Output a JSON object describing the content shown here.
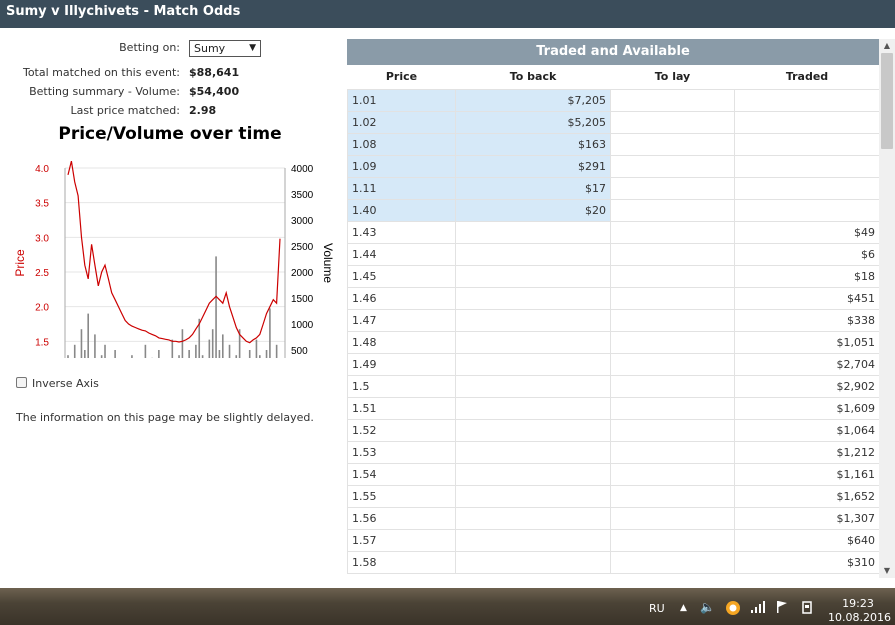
{
  "window": {
    "title": "Sumy v Illychivets - Match Odds"
  },
  "summary": {
    "betting_on_label": "Betting on:",
    "betting_on_value": "Sumy",
    "total_matched_label": "Total matched on this event:",
    "total_matched_value": "$88,641",
    "betting_summary_label": "Betting summary - Volume:",
    "betting_summary_value": "$54,400",
    "last_price_label": "Last price matched:",
    "last_price_value": "2.98"
  },
  "chart_data": {
    "type": "line",
    "title": "Price/Volume over time",
    "ylabel": "Price",
    "y2label": "Volume",
    "ylim": [
      1.0,
      4.0
    ],
    "y2lim": [
      0,
      4000
    ],
    "yticks": [
      "1.0",
      "1.5",
      "2.0",
      "2.5",
      "3.0",
      "3.5",
      "4.0"
    ],
    "y2ticks": [
      "0",
      "500",
      "1000",
      "1500",
      "2000",
      "2500",
      "3000",
      "3500",
      "4000"
    ],
    "grid": true,
    "series": [
      {
        "name": "Price",
        "color": "#cc0000",
        "values": [
          3.9,
          4.1,
          3.8,
          3.6,
          3.0,
          2.6,
          2.4,
          2.9,
          2.6,
          2.3,
          2.5,
          2.6,
          2.4,
          2.2,
          2.1,
          2.0,
          1.9,
          1.8,
          1.75,
          1.72,
          1.7,
          1.68,
          1.66,
          1.65,
          1.62,
          1.6,
          1.58,
          1.55,
          1.54,
          1.53,
          1.52,
          1.5,
          1.5,
          1.49,
          1.5,
          1.52,
          1.55,
          1.6,
          1.68,
          1.75,
          1.85,
          1.95,
          2.05,
          2.1,
          2.15,
          2.1,
          2.05,
          2.2,
          2.0,
          1.85,
          1.7,
          1.6,
          1.55,
          1.5,
          1.48,
          1.52,
          1.55,
          1.6,
          1.75,
          1.9,
          2.0,
          2.1,
          2.05,
          2.98
        ]
      },
      {
        "name": "Volume",
        "color": "#888888",
        "values": [
          400,
          200,
          600,
          300,
          900,
          500,
          1200,
          300,
          800,
          200,
          400,
          600,
          300,
          150,
          500,
          200,
          300,
          100,
          250,
          400,
          150,
          300,
          200,
          600,
          180,
          350,
          120,
          500,
          250,
          300,
          150,
          700,
          200,
          400,
          900,
          300,
          500,
          200,
          600,
          1100,
          400,
          300,
          700,
          900,
          2300,
          500,
          800,
          300,
          600,
          250,
          400,
          900,
          200,
          300,
          500,
          150,
          700,
          400,
          250,
          500,
          1300,
          300,
          600,
          200
        ]
      }
    ]
  },
  "controls": {
    "inverse_axis_label": "Inverse Axis"
  },
  "notice": "The information on this page may be slightly delayed.",
  "table": {
    "header": "Traded and Available",
    "columns": [
      "Price",
      "To back",
      "To lay",
      "Traded"
    ],
    "rows": [
      {
        "price": "1.01",
        "back": "$7,205",
        "lay": "",
        "traded": ""
      },
      {
        "price": "1.02",
        "back": "$5,205",
        "lay": "",
        "traded": ""
      },
      {
        "price": "1.08",
        "back": "$163",
        "lay": "",
        "traded": ""
      },
      {
        "price": "1.09",
        "back": "$291",
        "lay": "",
        "traded": ""
      },
      {
        "price": "1.11",
        "back": "$17",
        "lay": "",
        "traded": ""
      },
      {
        "price": "1.40",
        "back": "$20",
        "lay": "",
        "traded": ""
      },
      {
        "price": "1.43",
        "back": "",
        "lay": "",
        "traded": "$49"
      },
      {
        "price": "1.44",
        "back": "",
        "lay": "",
        "traded": "$6"
      },
      {
        "price": "1.45",
        "back": "",
        "lay": "",
        "traded": "$18"
      },
      {
        "price": "1.46",
        "back": "",
        "lay": "",
        "traded": "$451"
      },
      {
        "price": "1.47",
        "back": "",
        "lay": "",
        "traded": "$338"
      },
      {
        "price": "1.48",
        "back": "",
        "lay": "",
        "traded": "$1,051"
      },
      {
        "price": "1.49",
        "back": "",
        "lay": "",
        "traded": "$2,704"
      },
      {
        "price": "1.5",
        "back": "",
        "lay": "",
        "traded": "$2,902"
      },
      {
        "price": "1.51",
        "back": "",
        "lay": "",
        "traded": "$1,609"
      },
      {
        "price": "1.52",
        "back": "",
        "lay": "",
        "traded": "$1,064"
      },
      {
        "price": "1.53",
        "back": "",
        "lay": "",
        "traded": "$1,212"
      },
      {
        "price": "1.54",
        "back": "",
        "lay": "",
        "traded": "$1,161"
      },
      {
        "price": "1.55",
        "back": "",
        "lay": "",
        "traded": "$1,652"
      },
      {
        "price": "1.56",
        "back": "",
        "lay": "",
        "traded": "$1,307"
      },
      {
        "price": "1.57",
        "back": "",
        "lay": "",
        "traded": "$640"
      },
      {
        "price": "1.58",
        "back": "",
        "lay": "",
        "traded": "$310"
      }
    ]
  },
  "taskbar": {
    "language": "RU",
    "time": "19:23",
    "date": "10.08.2016"
  },
  "icons": {
    "tray_up": "chevron-up-icon",
    "volume": "speaker-icon",
    "app": "orange-ring-icon",
    "network": "signal-bars-icon",
    "flag": "flag-icon",
    "device": "device-icon"
  }
}
